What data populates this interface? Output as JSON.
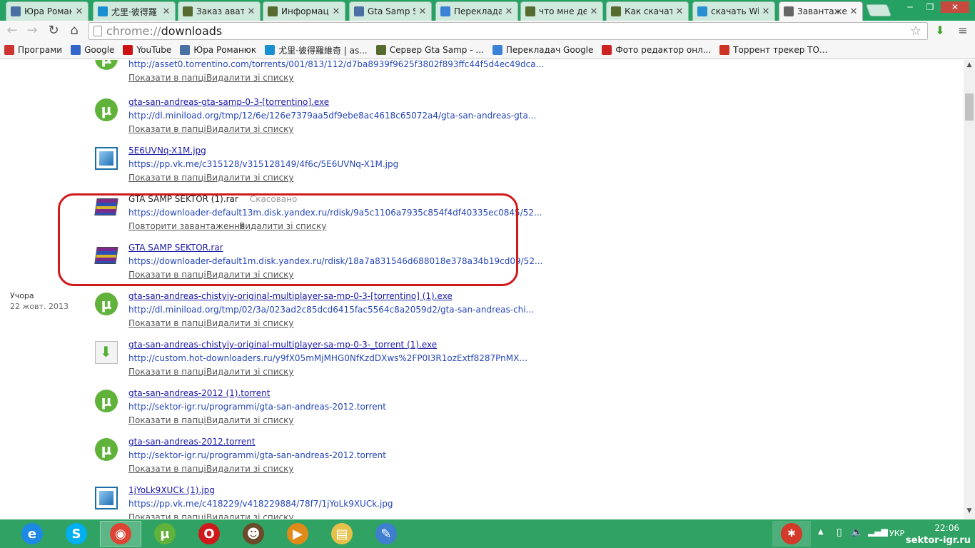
{
  "tabs": [
    {
      "title": "Юра Роман",
      "color": "#4a6fa5"
    },
    {
      "title": "尤里·彼得羅",
      "color": "#1a8fd0"
    },
    {
      "title": "Заказ аватар",
      "color": "#556b2f"
    },
    {
      "title": "Информаци",
      "color": "#556b2f"
    },
    {
      "title": "Gta Samp Se",
      "color": "#4a6fa5"
    },
    {
      "title": "Переклада",
      "color": "#3b82d6"
    },
    {
      "title": "что мне дел",
      "color": "#556b2f"
    },
    {
      "title": "Как скачать",
      "color": "#556b2f"
    },
    {
      "title": "скачать Win",
      "color": "#2a8fd0"
    },
    {
      "title": "Завантажен",
      "color": "#666666"
    }
  ],
  "omnibox": {
    "scheme": "chrome://",
    "path": "downloads"
  },
  "bookmarks": [
    {
      "label": "Програми",
      "icon": "apps-icon",
      "color": "#cc3333"
    },
    {
      "label": "Google",
      "icon": "google-icon",
      "color": "#3366cc"
    },
    {
      "label": "YouTube",
      "icon": "youtube-icon",
      "color": "#cc1111"
    },
    {
      "label": "Юра Романюк",
      "icon": "vk-icon",
      "color": "#4a6fa5"
    },
    {
      "label": "尤里·彼得羅維奇 | as...",
      "icon": "site-icon",
      "color": "#1a8fd0"
    },
    {
      "label": "Сервер Gta Samp - ...",
      "icon": "gta-icon",
      "color": "#556b2f"
    },
    {
      "label": "Перекладач Google",
      "icon": "translate-icon",
      "color": "#3b82d6"
    },
    {
      "label": "Фото редактор онл...",
      "icon": "x-icon",
      "color": "#cc2222"
    },
    {
      "label": "Торрент трекер ТО...",
      "icon": "tree-icon",
      "color": "#cc3322"
    }
  ],
  "actions": {
    "show": "Показати в папці",
    "remove": "Видалити зі списку",
    "retry": "Повторити завантаження"
  },
  "date_group": {
    "label": "Учора",
    "date": "22 жовт. 2013"
  },
  "downloads": [
    {
      "name": "",
      "url": "http://asset0.torrentino.com/torrents/001/813/112/d7ba8939f9625f3802f893ffc44f5d4ec49dca...",
      "icon": "utorrent",
      "status": "",
      "linked": true
    },
    {
      "name": "gta-san-andreas-gta-samp-0-3-[torrentino].exe",
      "url": "http://dl.miniload.org/tmp/12/6e/126e7379aa5df9ebe8ac4618c65072a4/gta-san-andreas-gta...",
      "icon": "utorrent",
      "status": "",
      "linked": true
    },
    {
      "name": "5E6UVNq-X1M.jpg",
      "url": "https://pp.vk.me/c315128/v315128149/4f6c/5E6UVNq-X1M.jpg",
      "icon": "image",
      "status": "",
      "linked": true
    },
    {
      "name": "GTA SAMP SEKTOR (1).rar",
      "url": "https://downloader-default13m.disk.yandex.ru/rdisk/9a5c1106a7935c854f4df40335ec0845/52...",
      "icon": "rar",
      "status": "Скасовано",
      "linked": false
    },
    {
      "name": "GTA SAMP SEKTOR.rar",
      "url": "https://downloader-default1m.disk.yandex.ru/rdisk/18a7a831546d688018e378a34b19cd09/52...",
      "icon": "rar",
      "status": "",
      "linked": true
    },
    {
      "name": "gta-san-andreas-chistyiy-original-multiplayer-sa-mp-0-3-[torrentino] (1).exe",
      "url": "http://dl.miniload.org/tmp/02/3a/023ad2c85dcd6415fac5564c8a2059d2/gta-san-andreas-chi...",
      "icon": "utorrent",
      "status": "",
      "linked": true
    },
    {
      "name": "gta-san-andreas-chistyiy-original-multiplayer-sa-mp-0-3-_torrent (1).exe",
      "url": "http://custom.hot-downloaders.ru/y9fX05mMjMHG0NfKzdDXws%2FP0I3R1ozExtf8287PnMX...",
      "icon": "download",
      "status": "",
      "linked": true
    },
    {
      "name": "gta-san-andreas-2012 (1).torrent",
      "url": "http://sektor-igr.ru/programmi/gta-san-andreas-2012.torrent",
      "icon": "utorrent",
      "status": "",
      "linked": true
    },
    {
      "name": "gta-san-andreas-2012.torrent",
      "url": "http://sektor-igr.ru/programmi/gta-san-andreas-2012.torrent",
      "icon": "utorrent",
      "status": "",
      "linked": true
    },
    {
      "name": "1jYoLk9XUCk (1).jpg",
      "url": "https://pp.vk.me/c418229/v418229884/78f7/1jYoLk9XUCk.jpg",
      "icon": "image",
      "status": "",
      "linked": true
    }
  ],
  "taskbar": [
    {
      "name": "ie-icon",
      "glyph": "e",
      "color": "#1e88e5",
      "active": false
    },
    {
      "name": "skype-icon",
      "glyph": "S",
      "color": "#00aff0",
      "active": false
    },
    {
      "name": "chrome-icon",
      "glyph": "◉",
      "color": "#dd4433",
      "active": true
    },
    {
      "name": "utorrent-icon",
      "glyph": "µ",
      "color": "#60b23a",
      "active": false
    },
    {
      "name": "opera-icon",
      "glyph": "O",
      "color": "#d0191b",
      "active": false
    },
    {
      "name": "game-icon",
      "glyph": "☻",
      "color": "#6b4b2a",
      "active": false
    },
    {
      "name": "media-player-icon",
      "glyph": "▶",
      "color": "#e08a1a",
      "active": false
    },
    {
      "name": "file-explorer-icon",
      "glyph": "▤",
      "color": "#e7c04a",
      "active": false
    },
    {
      "name": "paint-icon",
      "glyph": "✎",
      "color": "#3f7fd0",
      "active": false
    }
  ],
  "tray": {
    "language": "УКР",
    "time": "22:06",
    "watermark": "sektor-igr.ru"
  }
}
